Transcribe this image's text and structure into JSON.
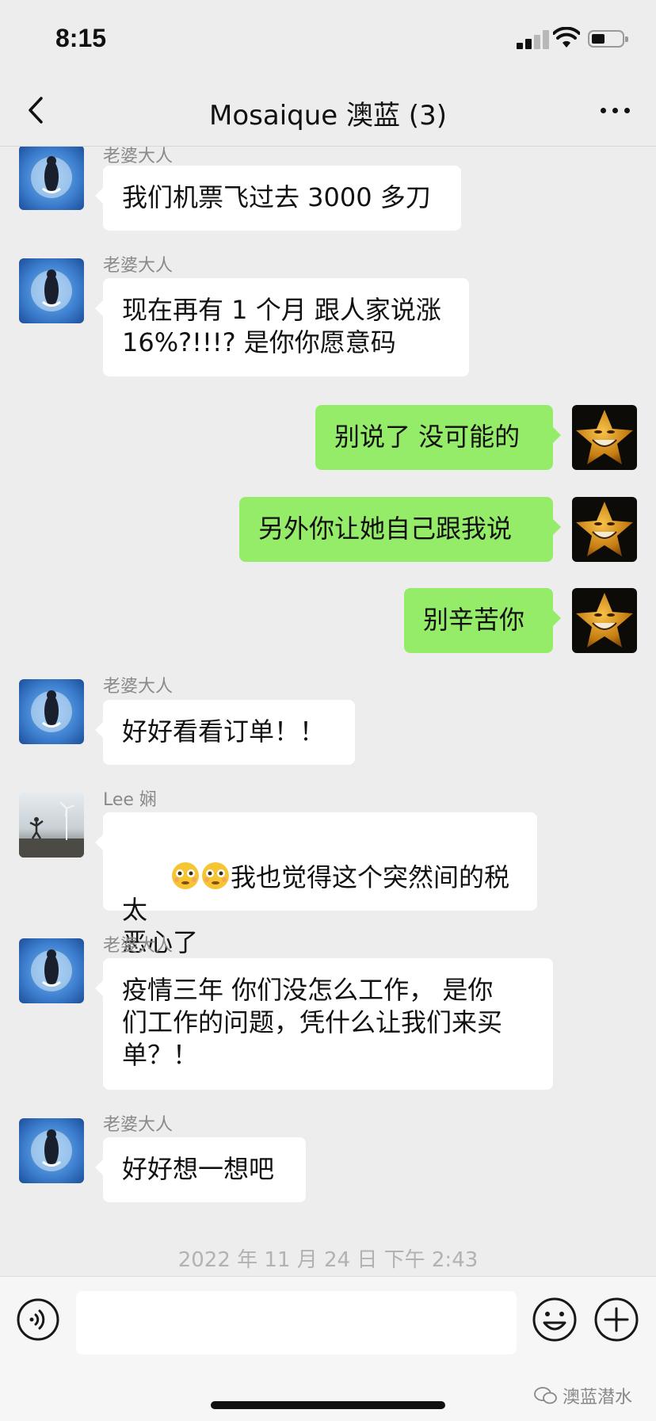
{
  "status_bar": {
    "time": "8:15"
  },
  "header": {
    "title": "Mosaique 澳蓝 (3)"
  },
  "messages": [
    {
      "sender": "老婆大人",
      "text": "我们机票飞过去 3000 多刀"
    },
    {
      "sender": "老婆大人",
      "text": "现在再有 1 个月 跟人家说涨\n16%?!!!? 是你你愿意码"
    },
    {
      "text": "别说了 没可能的"
    },
    {
      "text": "另外你让她自己跟我说"
    },
    {
      "text": "别辛苦你"
    },
    {
      "sender": "老婆大人",
      "text": "好好看看订单！！"
    },
    {
      "sender": "Lee 娴",
      "text": "我也觉得这个突然间的税太\n恶心了"
    },
    {
      "sender": "老婆大人",
      "text": "疫情三年 你们没怎么工作， 是你\n们工作的问题，凭什么让我们来买\n单？！"
    },
    {
      "sender": "老婆大人",
      "text": "好好想一想吧"
    }
  ],
  "timestamp": "2022 年 11 月 24 日  下午 2:43",
  "input": {
    "value": "",
    "placeholder": ""
  },
  "watermark": "澳蓝潜水",
  "colors": {
    "background": "#ededed",
    "outgoing_bubble": "#95ec69",
    "incoming_bubble": "#ffffff",
    "meta_text": "#8a8a8a"
  },
  "icons": [
    "back-chevron-icon",
    "more-dots-icon",
    "voice-icon",
    "emoji-icon",
    "plus-icon",
    "wechat-icon"
  ]
}
